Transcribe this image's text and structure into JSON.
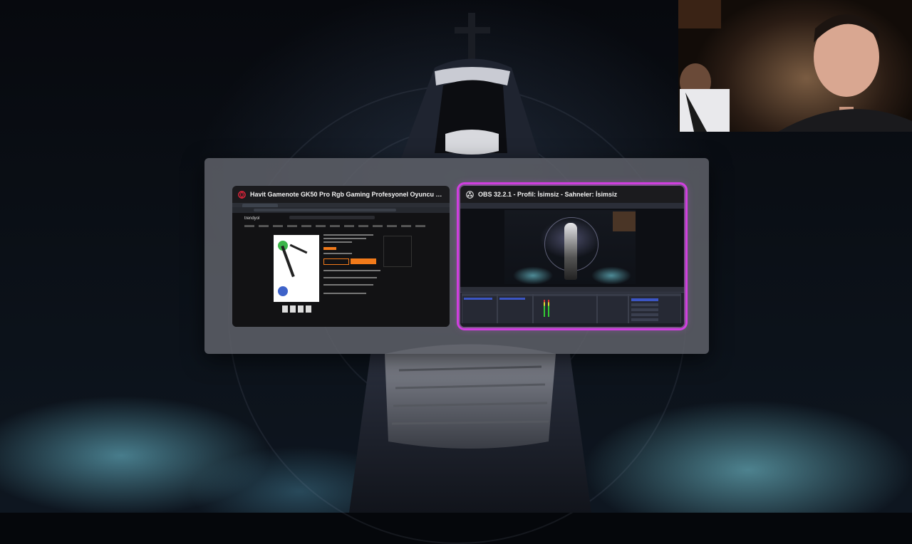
{
  "task_switcher": {
    "windows": [
      {
        "title": "Havit Gamenote GK50 Pro Rgb Gaming Profesyonel Oyuncu Yayıncı Mikrof...",
        "app_icon": "opera-gx-icon",
        "selected": false
      },
      {
        "title": "OBS 32.2.1 - Profil: İsimsiz - Sahneler: İsimsiz",
        "app_icon": "obs-icon",
        "selected": true
      }
    ]
  },
  "browser_thumbnail": {
    "site_logo": "trendyol"
  },
  "colors": {
    "selection_highlight": "#d13ee0",
    "switcher_background": "#5c5e66",
    "browser_accent": "#f27a1a",
    "obs_accent": "#3b55c4"
  }
}
